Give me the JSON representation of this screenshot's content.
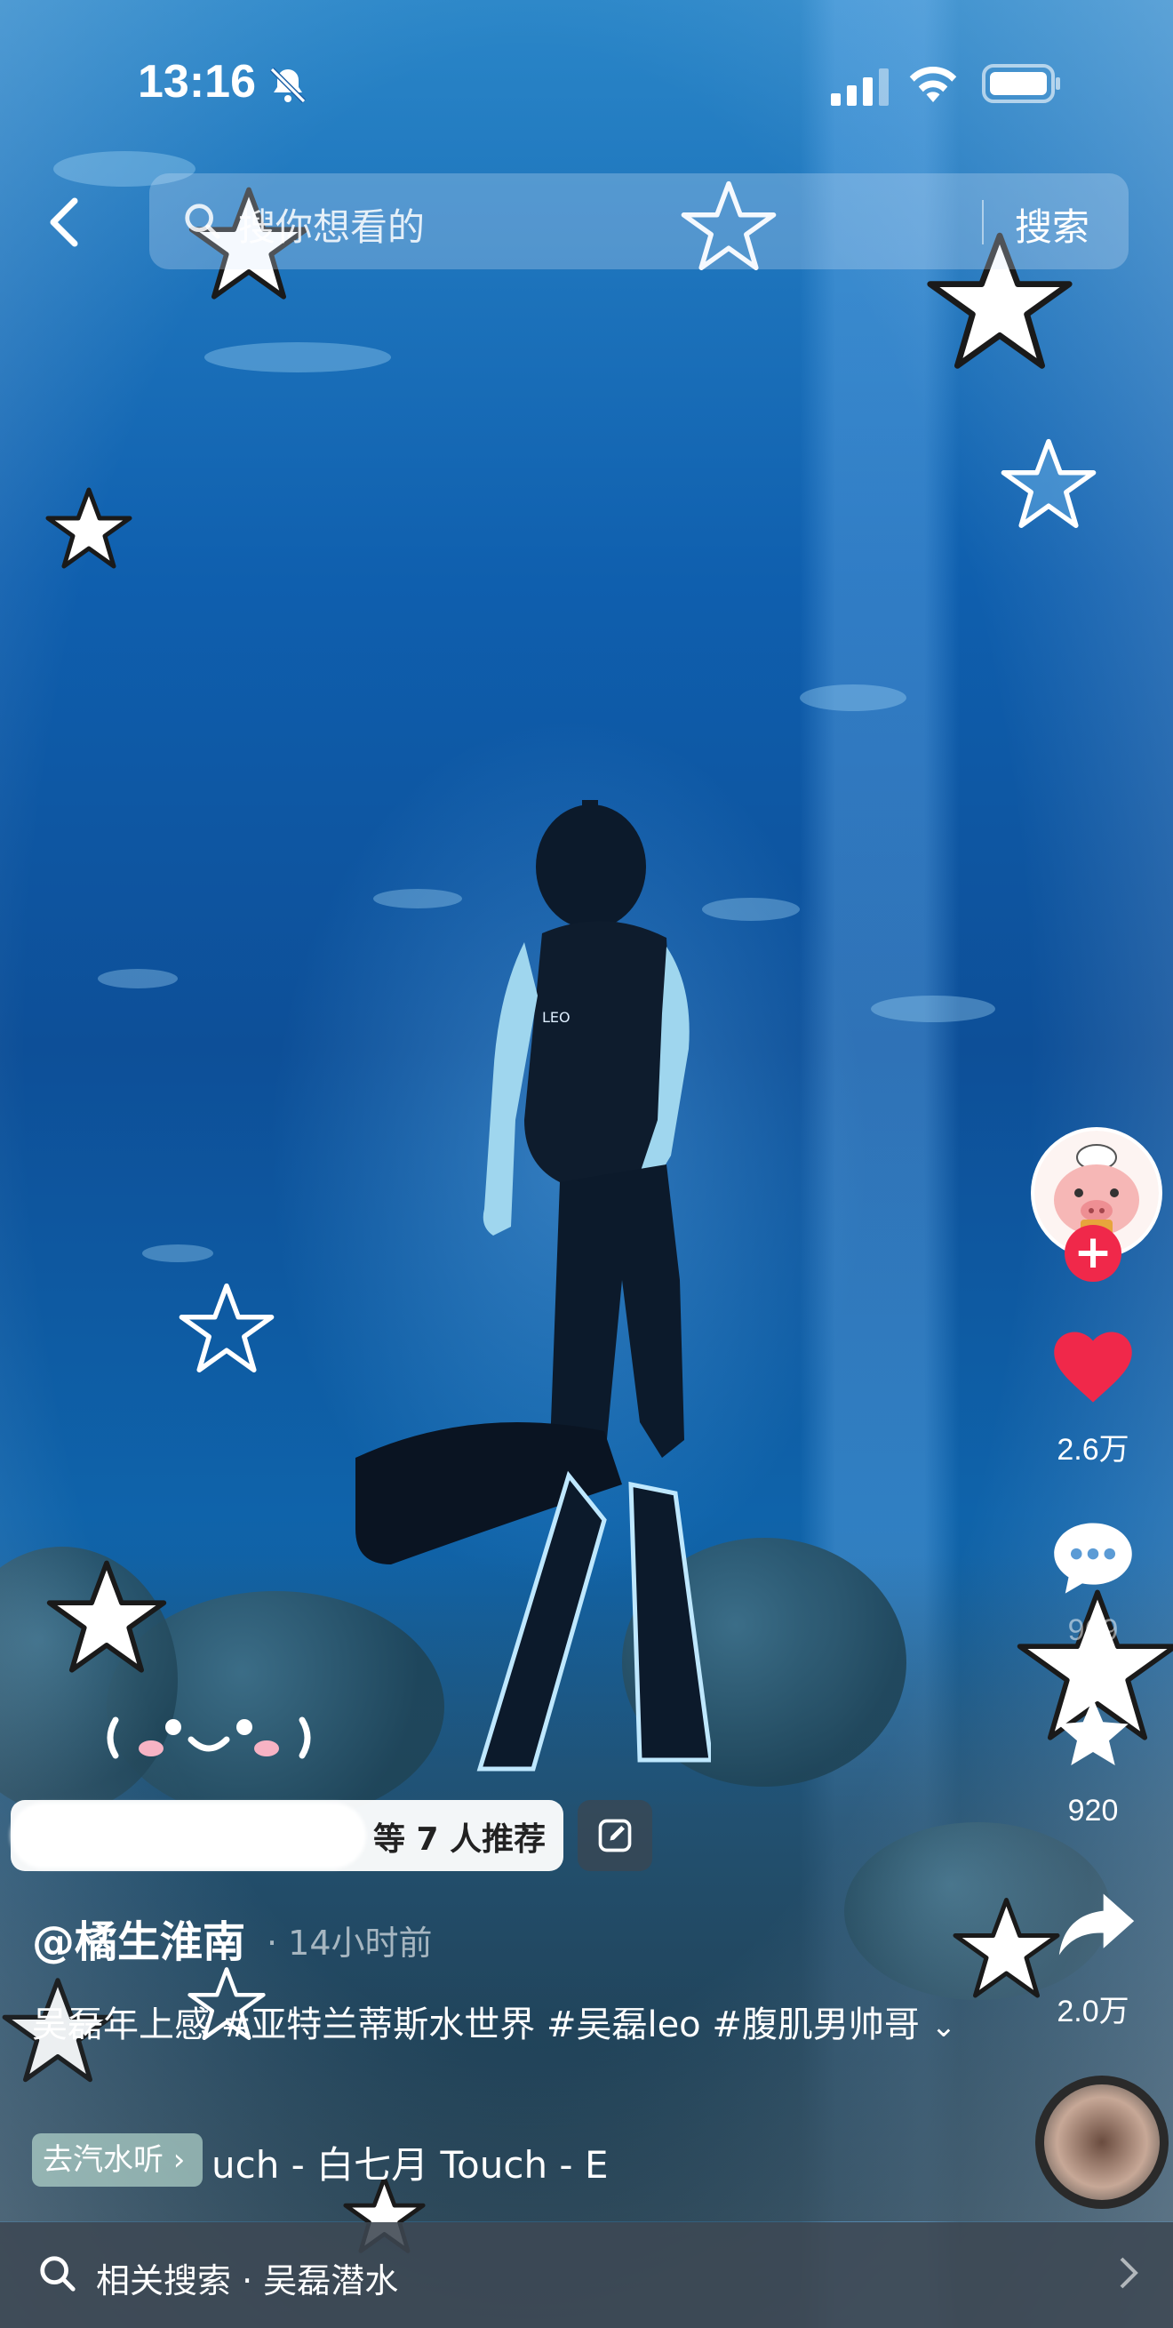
{
  "status_bar": {
    "time": "13:16"
  },
  "search": {
    "placeholder": "搜你想看的",
    "button": "搜索"
  },
  "actions": {
    "like_count": "2.6万",
    "comment_count": "969",
    "favorite_count": "920",
    "share_count": "2.0万"
  },
  "recommend": {
    "text": "等 7 人推荐"
  },
  "post": {
    "author": "@橘生淮南",
    "time_ago": "· 14小时前",
    "caption": "吴磊年上感 #亚特兰蒂斯水世界  #吴磊leo #腹肌男帅哥",
    "expand": "⌄"
  },
  "music": {
    "tag": "去汽水听 ›",
    "name": "uch - 白七月    Touch - E"
  },
  "related": {
    "label": "相关搜索 · 吴磊潜水"
  },
  "colors": {
    "like": "#f0284a",
    "follow": "#f0284a"
  },
  "icons": [
    "bell-slash-icon",
    "signal-icon",
    "wifi-icon",
    "battery-icon",
    "back-icon",
    "search-icon",
    "heart-icon",
    "comment-icon",
    "star-icon",
    "share-icon",
    "edit-icon",
    "chevron-right-icon"
  ]
}
